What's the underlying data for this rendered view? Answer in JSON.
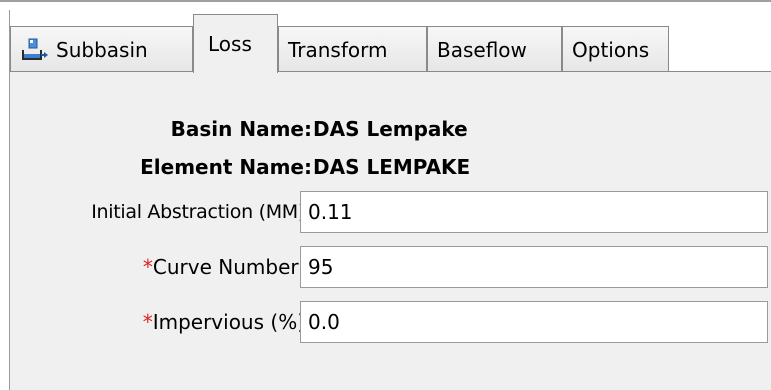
{
  "tabs": [
    {
      "id": "subbasin",
      "label": "Subbasin",
      "icon": "subbasin-icon",
      "active": false
    },
    {
      "id": "loss",
      "label": "Loss",
      "active": true
    },
    {
      "id": "transform",
      "label": "Transform",
      "active": false
    },
    {
      "id": "baseflow",
      "label": "Baseflow",
      "active": false
    },
    {
      "id": "options",
      "label": "Options",
      "active": false
    }
  ],
  "basin": {
    "label": "Basin Name:",
    "value": "DAS Lempake"
  },
  "element": {
    "label": "Element Name:",
    "value": "DAS LEMPAKE"
  },
  "fields": {
    "initial_abstraction": {
      "label": "Initial Abstraction (MM)",
      "value": "0.11",
      "required": false
    },
    "curve_number": {
      "required_mark": "*",
      "label": "Curve Number:",
      "value": "95",
      "required": true
    },
    "impervious": {
      "required_mark": "*",
      "label": "Impervious (%)",
      "value": "0.0",
      "required": true
    }
  },
  "colors": {
    "required_mark": "#e02020",
    "panel_background": "#f0f0f0",
    "field_border": "#9a9a9a"
  }
}
